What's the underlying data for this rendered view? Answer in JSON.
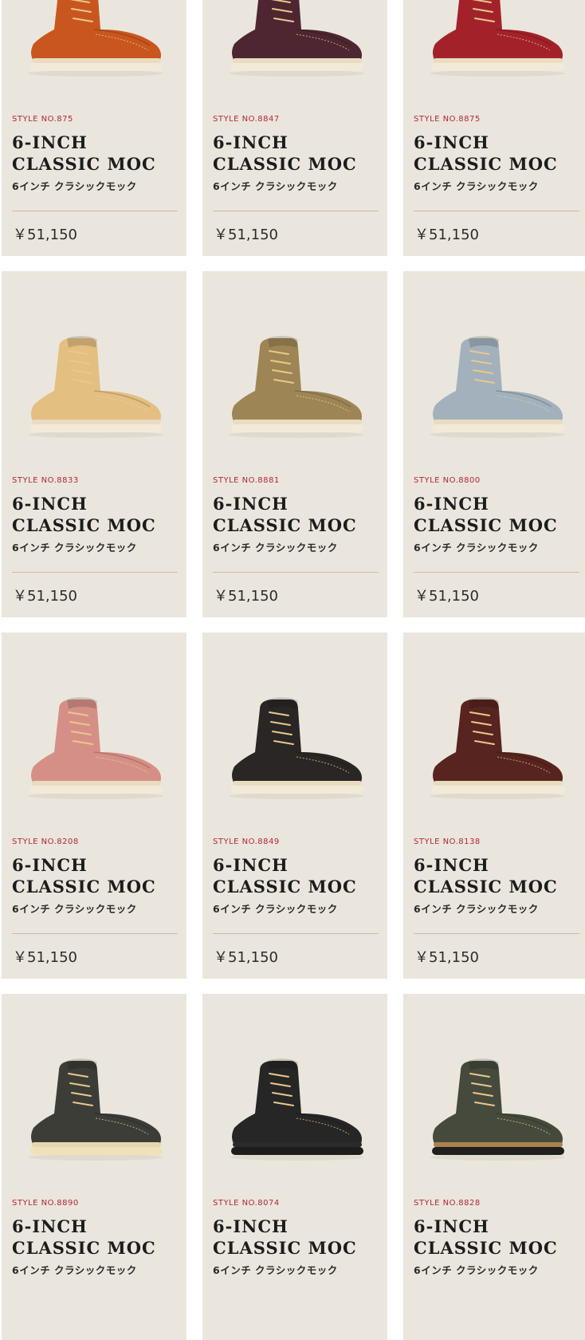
{
  "products": [
    {
      "style_no": "STYLE NO.875",
      "title": "6-INCH CLASSIC MOC",
      "subtitle": "6インチ クラシックモック",
      "price": "￥51,150",
      "color": "#c9561f",
      "sole": "#f2ead8",
      "welt": "#e9dcc0"
    },
    {
      "style_no": "STYLE NO.8847",
      "title": "6-INCH CLASSIC MOC",
      "subtitle": "6インチ クラシックモック",
      "price": "￥51,150",
      "color": "#4e2631",
      "sole": "#f2ead8",
      "welt": "#e9dcc0"
    },
    {
      "style_no": "STYLE NO.8875",
      "title": "6-INCH CLASSIC MOC",
      "subtitle": "6インチ クラシックモック",
      "price": "￥51,150",
      "color": "#a3222a",
      "sole": "#f2ead8",
      "welt": "#e9dcc0"
    },
    {
      "style_no": "STYLE NO.8833",
      "title": "6-INCH CLASSIC MOC",
      "subtitle": "6インチ クラシックモック",
      "price": "￥51,150",
      "color": "#e3bf82",
      "sole": "#f2ead8",
      "welt": "#e9dcc0"
    },
    {
      "style_no": "STYLE NO.8881",
      "title": "6-INCH CLASSIC MOC",
      "subtitle": "6インチ クラシックモック",
      "price": "￥51,150",
      "color": "#9e8555",
      "sole": "#f2ead8",
      "welt": "#e9dcc0"
    },
    {
      "style_no": "STYLE NO.8800",
      "title": "6-INCH CLASSIC MOC",
      "subtitle": "6インチ クラシックモック",
      "price": "￥51,150",
      "color": "#a2b1bc",
      "sole": "#f2ead8",
      "welt": "#e9dcc0"
    },
    {
      "style_no": "STYLE NO.8208",
      "title": "6-INCH CLASSIC MOC",
      "subtitle": "6インチ クラシックモック",
      "price": "￥51,150",
      "color": "#d68f86",
      "sole": "#f2ead8",
      "welt": "#e9dcc0"
    },
    {
      "style_no": "STYLE NO.8849",
      "title": "6-INCH CLASSIC MOC",
      "subtitle": "6インチ クラシックモック",
      "price": "￥51,150",
      "color": "#2a2625",
      "sole": "#f2ead8",
      "welt": "#e9dcc0"
    },
    {
      "style_no": "STYLE NO.8138",
      "title": "6-INCH CLASSIC MOC",
      "subtitle": "6インチ クラシックモック",
      "price": "￥51,150",
      "color": "#58241f",
      "sole": "#f2ead8",
      "welt": "#e9dcc0"
    },
    {
      "style_no": "STYLE NO.8890",
      "title": "6-INCH CLASSIC MOC",
      "subtitle": "6インチ クラシックモック",
      "price": "",
      "color": "#3c3d37",
      "sole": "#efe2b8",
      "welt": "#e4d6ae"
    },
    {
      "style_no": "STYLE NO.8074",
      "title": "6-INCH CLASSIC MOC",
      "subtitle": "6インチ クラシックモック",
      "price": "",
      "color": "#262626",
      "sole": "#1d1d1d",
      "welt": "#2a2a2a"
    },
    {
      "style_no": "STYLE NO.8828",
      "title": "6-INCH CLASSIC MOC",
      "subtitle": "6インチ クラシックモック",
      "price": "",
      "color": "#454a3c",
      "sole": "#1f1f1f",
      "welt": "#a8824f"
    }
  ]
}
